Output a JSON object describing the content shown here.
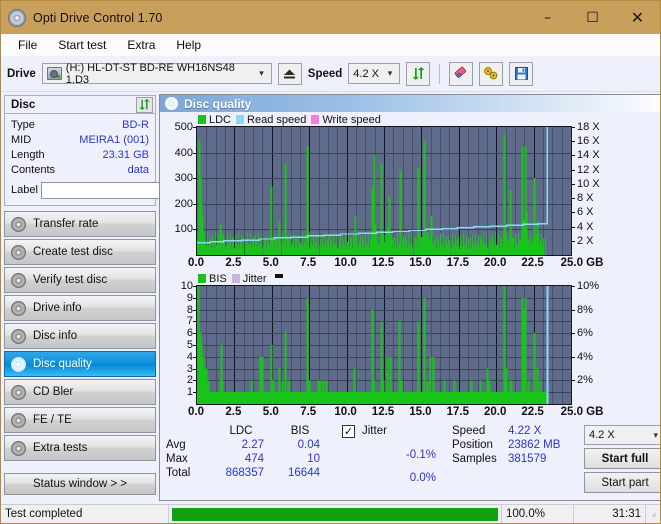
{
  "window": {
    "title": "Opti Drive Control 1.70",
    "icon": "disc-icon",
    "minimize": "–",
    "maximize": "☐",
    "close": "✕"
  },
  "menu": {
    "items": [
      "File",
      "Start test",
      "Extra",
      "Help"
    ]
  },
  "toolbar": {
    "drive_label": "Drive",
    "drive_value": "(H:)  HL-DT-ST BD-RE  WH16NS48 1.D3",
    "eject_icon": "eject-icon",
    "speed_label": "Speed",
    "speed_value": "4.2 X",
    "refresh_icon": "refresh-icon",
    "eraser_icon": "eraser-icon",
    "tools_icon": "tools-icon",
    "save_icon": "save-icon",
    "dropdown_arrow": "⌄"
  },
  "disc_panel": {
    "title": "Disc",
    "refresh_icon": "refresh-icon",
    "rows": [
      {
        "key": "Type",
        "value": "BD-R"
      },
      {
        "key": "MID",
        "value": "MEIRA1 (001)"
      },
      {
        "key": "Length",
        "value": "23.31 GB"
      },
      {
        "key": "Contents",
        "value": "data"
      }
    ],
    "label_key": "Label",
    "label_value": "",
    "label_placeholder": "",
    "label_button_icon": "disc-icon"
  },
  "sidebar": {
    "items": [
      {
        "label": "Transfer rate",
        "icon": "disc-icon",
        "active": false
      },
      {
        "label": "Create test disc",
        "icon": "disc-icon",
        "active": false
      },
      {
        "label": "Verify test disc",
        "icon": "disc-icon",
        "active": false
      },
      {
        "label": "Drive info",
        "icon": "disc-icon",
        "active": false
      },
      {
        "label": "Disc info",
        "icon": "disc-icon",
        "active": false
      },
      {
        "label": "Disc quality",
        "icon": "disc-icon",
        "active": true
      },
      {
        "label": "CD Bler",
        "icon": "disc-icon",
        "active": false
      },
      {
        "label": "FE / TE",
        "icon": "disc-icon",
        "active": false
      },
      {
        "label": "Extra tests",
        "icon": "disc-icon",
        "active": false
      }
    ],
    "status_window": "Status window > >"
  },
  "main": {
    "header_title": "Disc quality",
    "header_icon": "disc-icon"
  },
  "stats": {
    "col_headers": [
      "LDC",
      "BIS"
    ],
    "row_labels": [
      "Avg",
      "Max",
      "Total"
    ],
    "ldc": [
      "2.27",
      "474",
      "868357"
    ],
    "bis": [
      "0.04",
      "10",
      "16644"
    ],
    "jitter_label": "Jitter",
    "jitter_checked": true,
    "jitter_check_glyph": "✓",
    "jitter_values": [
      "-0.1%",
      "0.0%"
    ],
    "speed_label": "Speed",
    "speed_value": "4.22 X",
    "position_label": "Position",
    "position_value": "23862 MB",
    "samples_label": "Samples",
    "samples_value": "381579",
    "speed_select": "4.2 X",
    "start_full": "Start full",
    "start_part": "Start part"
  },
  "statusbar": {
    "message": "Test completed",
    "progress_pct": 100.0,
    "progress_text": "100.0%",
    "elapsed": "31:31"
  },
  "colors": {
    "accent_blue": "#2d35d6",
    "ldc_green": "#19c419",
    "read_speed": "#8fd8f5",
    "write_speed": "#f57ce0",
    "jitter": "#c9b6dd",
    "plot_bg": "#5e6b8b",
    "progress_green": "#12a112",
    "title_bar": "#c8a05c"
  },
  "chart_data": [
    {
      "type": "line",
      "title": "LDC / Read speed vs disc position",
      "xlabel": "GB",
      "ylabel": "LDC",
      "y2label": "X",
      "xlim": [
        0,
        25
      ],
      "xticks": [
        "0.0",
        "2.5",
        "5.0",
        "7.5",
        "10.0",
        "12.5",
        "15.0",
        "17.5",
        "20.0",
        "22.5",
        "25.0 GB"
      ],
      "ylim": [
        0,
        500
      ],
      "yticks": [
        100,
        200,
        300,
        400,
        500
      ],
      "y2lim": [
        0,
        18
      ],
      "y2ticks": [
        "2 X",
        "4 X",
        "6 X",
        "8 X",
        "10 X",
        "12 X",
        "14 X",
        "16 X",
        "18 X"
      ],
      "grid": true,
      "legend": [
        {
          "name": "LDC",
          "color": "#19c419"
        },
        {
          "name": "Read speed",
          "color": "#8fd8f5"
        },
        {
          "name": "Write speed",
          "color": "#f57ce0"
        }
      ],
      "series": [
        {
          "name": "LDC",
          "color": "#19c419",
          "type": "impulse",
          "points": [
            [
              0.05,
              60
            ],
            [
              0.12,
              445
            ],
            [
              0.2,
              300
            ],
            [
              0.28,
              200
            ],
            [
              0.33,
              150
            ],
            [
              0.4,
              90
            ],
            [
              0.5,
              60
            ],
            [
              0.6,
              40
            ],
            [
              0.75,
              35
            ],
            [
              0.9,
              30
            ],
            [
              1.1,
              55
            ],
            [
              1.3,
              40
            ],
            [
              1.55,
              120
            ],
            [
              1.62,
              85
            ],
            [
              1.7,
              60
            ],
            [
              1.85,
              35
            ],
            [
              2.1,
              40
            ],
            [
              2.4,
              30
            ],
            [
              2.7,
              35
            ],
            [
              3.0,
              28
            ],
            [
              3.3,
              45
            ],
            [
              3.6,
              30
            ],
            [
              3.9,
              35
            ],
            [
              4.2,
              30
            ],
            [
              4.5,
              40
            ],
            [
              4.75,
              28
            ],
            [
              4.95,
              265
            ],
            [
              5.05,
              70
            ],
            [
              5.3,
              45
            ],
            [
              5.5,
              130
            ],
            [
              5.65,
              55
            ],
            [
              5.9,
              355
            ],
            [
              6.05,
              60
            ],
            [
              6.3,
              40
            ],
            [
              6.6,
              35
            ],
            [
              6.9,
              45
            ],
            [
              7.15,
              28
            ],
            [
              7.35,
              425
            ],
            [
              7.45,
              90
            ],
            [
              7.6,
              40
            ],
            [
              7.9,
              30
            ],
            [
              8.2,
              40
            ],
            [
              8.5,
              35
            ],
            [
              8.8,
              30
            ],
            [
              9.1,
              38
            ],
            [
              9.4,
              30
            ],
            [
              9.7,
              35
            ],
            [
              10.0,
              40
            ],
            [
              10.3,
              30
            ],
            [
              10.55,
              150
            ],
            [
              10.7,
              45
            ],
            [
              11.0,
              35
            ],
            [
              11.3,
              40
            ],
            [
              11.5,
              30
            ],
            [
              11.7,
              260
            ],
            [
              11.8,
              390
            ],
            [
              11.9,
              120
            ],
            [
              12.05,
              55
            ],
            [
              12.2,
              45
            ],
            [
              12.3,
              360
            ],
            [
              12.4,
              80
            ],
            [
              12.55,
              50
            ],
            [
              12.7,
              110
            ],
            [
              12.85,
              230
            ],
            [
              12.95,
              60
            ],
            [
              13.2,
              40
            ],
            [
              13.45,
              45
            ],
            [
              13.6,
              330
            ],
            [
              13.75,
              60
            ],
            [
              14.0,
              45
            ],
            [
              14.3,
              35
            ],
            [
              14.6,
              60
            ],
            [
              14.8,
              340
            ],
            [
              14.95,
              70
            ],
            [
              15.1,
              50
            ],
            [
              15.2,
              445
            ],
            [
              15.35,
              90
            ],
            [
              15.5,
              60
            ],
            [
              15.65,
              150
            ],
            [
              15.8,
              45
            ],
            [
              16.1,
              40
            ],
            [
              16.4,
              35
            ],
            [
              16.7,
              45
            ],
            [
              17.0,
              30
            ],
            [
              17.3,
              40
            ],
            [
              17.6,
              35
            ],
            [
              17.9,
              45
            ],
            [
              18.2,
              30
            ],
            [
              18.5,
              40
            ],
            [
              18.8,
              35
            ],
            [
              19.1,
              45
            ],
            [
              19.4,
              30
            ],
            [
              19.7,
              55
            ],
            [
              20.0,
              40
            ],
            [
              20.3,
              45
            ],
            [
              20.5,
              470
            ],
            [
              20.6,
              120
            ],
            [
              20.75,
              60
            ],
            [
              20.9,
              255
            ],
            [
              21.05,
              70
            ],
            [
              21.3,
              45
            ],
            [
              21.5,
              55
            ],
            [
              21.7,
              420
            ],
            [
              21.8,
              140
            ],
            [
              21.9,
              425
            ],
            [
              22.0,
              170
            ],
            [
              22.15,
              60
            ],
            [
              22.3,
              45
            ],
            [
              22.5,
              300
            ],
            [
              22.6,
              80
            ],
            [
              22.75,
              130
            ],
            [
              22.9,
              55
            ],
            [
              23.0,
              45
            ]
          ]
        },
        {
          "name": "Read speed",
          "color": "#8fd8f5",
          "type": "step",
          "points": [
            [
              0.0,
              1.75
            ],
            [
              0.9,
              1.85
            ],
            [
              1.8,
              2.0
            ],
            [
              3.0,
              2.1
            ],
            [
              4.2,
              2.25
            ],
            [
              5.2,
              2.4
            ],
            [
              6.3,
              2.5
            ],
            [
              7.4,
              2.7
            ],
            [
              8.5,
              2.8
            ],
            [
              9.6,
              2.95
            ],
            [
              10.8,
              3.05
            ],
            [
              12.0,
              3.2
            ],
            [
              13.1,
              3.3
            ],
            [
              14.2,
              3.45
            ],
            [
              15.3,
              3.6
            ],
            [
              16.4,
              3.7
            ],
            [
              17.4,
              3.85
            ],
            [
              18.5,
              3.95
            ],
            [
              19.6,
              4.05
            ],
            [
              20.7,
              4.2
            ],
            [
              21.8,
              4.3
            ],
            [
              22.8,
              4.4
            ],
            [
              23.35,
              4.4
            ],
            [
              23.4,
              18.0
            ]
          ]
        }
      ]
    },
    {
      "type": "line",
      "title": "BIS / Jitter vs disc position",
      "xlabel": "GB",
      "ylabel": "BIS",
      "y2label": "%",
      "xlim": [
        0,
        25
      ],
      "xticks": [
        "0.0",
        "2.5",
        "5.0",
        "7.5",
        "10.0",
        "12.5",
        "15.0",
        "17.5",
        "20.0",
        "22.5",
        "25.0 GB"
      ],
      "ylim": [
        0,
        10
      ],
      "yticks": [
        1,
        2,
        3,
        4,
        5,
        6,
        7,
        8,
        9,
        10
      ],
      "y2lim": [
        0,
        10
      ],
      "y2ticks": [
        "2%",
        "4%",
        "6%",
        "8%",
        "10%"
      ],
      "grid": true,
      "legend": [
        {
          "name": "BIS",
          "color": "#19c419"
        },
        {
          "name": "Jitter",
          "color": "#c9b6dd"
        }
      ],
      "series": [
        {
          "name": "BIS",
          "color": "#19c419",
          "type": "impulse",
          "baseline": 1,
          "points": [
            [
              0.1,
              10
            ],
            [
              0.2,
              6
            ],
            [
              0.3,
              5
            ],
            [
              0.4,
              4
            ],
            [
              0.5,
              3
            ],
            [
              0.62,
              3
            ],
            [
              0.75,
              2
            ],
            [
              1.55,
              2
            ],
            [
              1.62,
              5
            ],
            [
              1.7,
              2
            ],
            [
              3.6,
              2
            ],
            [
              4.2,
              4
            ],
            [
              4.35,
              4
            ],
            [
              4.95,
              5
            ],
            [
              5.05,
              2
            ],
            [
              5.5,
              3
            ],
            [
              5.65,
              2
            ],
            [
              5.9,
              6
            ],
            [
              6.1,
              2
            ],
            [
              7.35,
              9
            ],
            [
              7.5,
              2
            ],
            [
              8.1,
              2
            ],
            [
              8.25,
              2
            ],
            [
              8.4,
              2
            ],
            [
              8.6,
              2
            ],
            [
              10.5,
              3
            ],
            [
              11.7,
              8
            ],
            [
              11.85,
              2
            ],
            [
              12.3,
              7
            ],
            [
              12.45,
              2
            ],
            [
              12.7,
              4
            ],
            [
              12.9,
              4
            ],
            [
              13.5,
              7
            ],
            [
              13.65,
              2
            ],
            [
              14.8,
              7
            ],
            [
              15.15,
              9
            ],
            [
              15.35,
              2
            ],
            [
              15.6,
              4
            ],
            [
              15.75,
              4
            ],
            [
              16.5,
              2
            ],
            [
              17.2,
              2
            ],
            [
              18.3,
              2
            ],
            [
              18.9,
              2
            ],
            [
              19.4,
              3
            ],
            [
              19.55,
              2
            ],
            [
              20.5,
              10
            ],
            [
              20.65,
              3
            ],
            [
              20.9,
              2
            ],
            [
              21.0,
              2
            ],
            [
              21.7,
              9
            ],
            [
              21.85,
              8
            ],
            [
              21.95,
              9
            ],
            [
              22.1,
              2
            ],
            [
              22.5,
              6
            ],
            [
              22.7,
              3
            ],
            [
              22.9,
              2
            ]
          ]
        },
        {
          "name": "Read speed marker",
          "color": "#8fd8f5",
          "type": "vline",
          "points": [
            [
              23.4,
              10
            ]
          ]
        }
      ]
    }
  ]
}
